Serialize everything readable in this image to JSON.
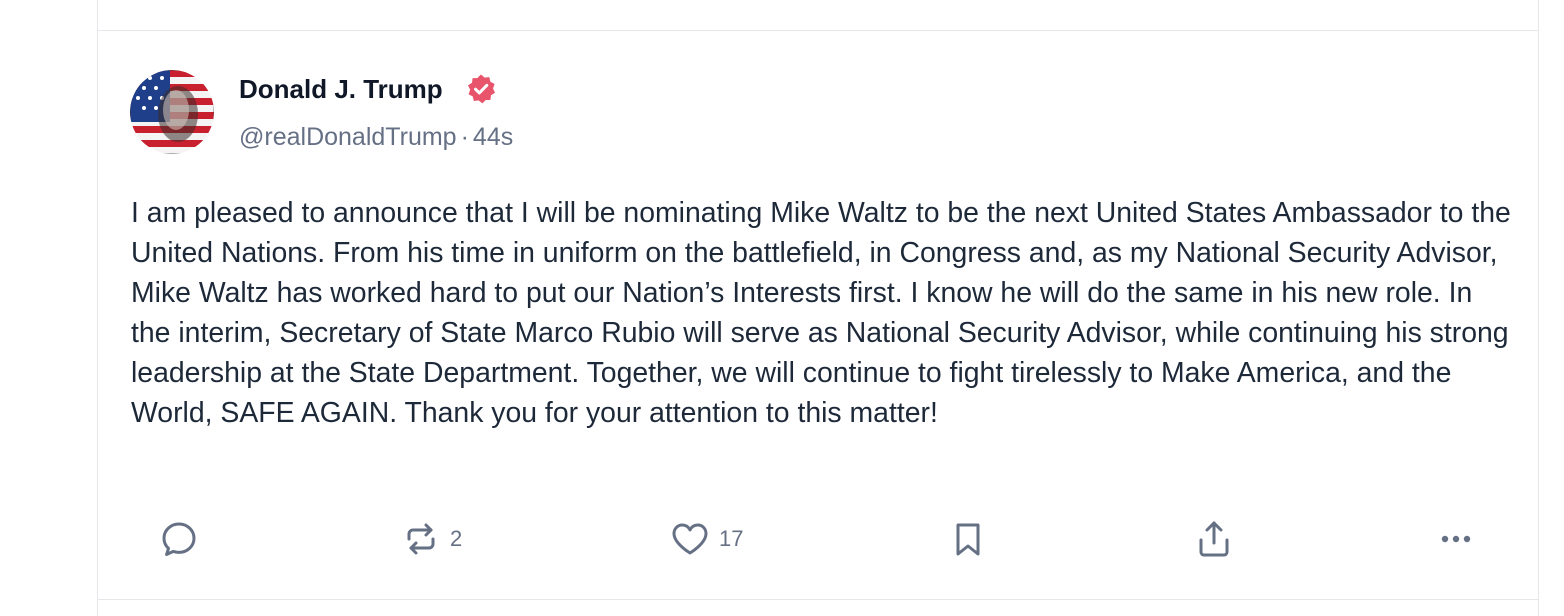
{
  "post": {
    "author": {
      "display_name": "Donald J. Trump",
      "handle": "@realDonaldTrump",
      "verified": true,
      "avatar_icon": "avatar-flag-portrait"
    },
    "separator": "·",
    "timestamp": "44s",
    "body": "I am pleased to announce that I will be nominating Mike Waltz to be the next United States Ambassador to the United Nations. From his time in uniform on the battlefield, in Congress and, as my National Security Advisor, Mike Waltz has worked hard to put our Nation’s Interests first. I know he will do the same in his new role. In the interim, Secretary of State Marco Rubio will serve as National Security Advisor, while continuing his strong leadership at the State Department. Together, we will continue to fight tirelessly to Make America, and the World, SAFE AGAIN. Thank you for your attention to this matter!",
    "actions": {
      "reply": {
        "icon": "reply-icon",
        "count": ""
      },
      "repost": {
        "icon": "repost-icon",
        "count": "2"
      },
      "like": {
        "icon": "heart-icon",
        "count": "17"
      },
      "bookmark": {
        "icon": "bookmark-icon",
        "count": ""
      },
      "share": {
        "icon": "share-icon",
        "count": ""
      },
      "more": {
        "icon": "more-icon",
        "count": ""
      }
    }
  },
  "colors": {
    "verified_badge": "#e8546b",
    "icon_gray": "#667085",
    "text_primary": "#101828",
    "text_body": "#1d2939",
    "border": "#e5e7eb"
  }
}
